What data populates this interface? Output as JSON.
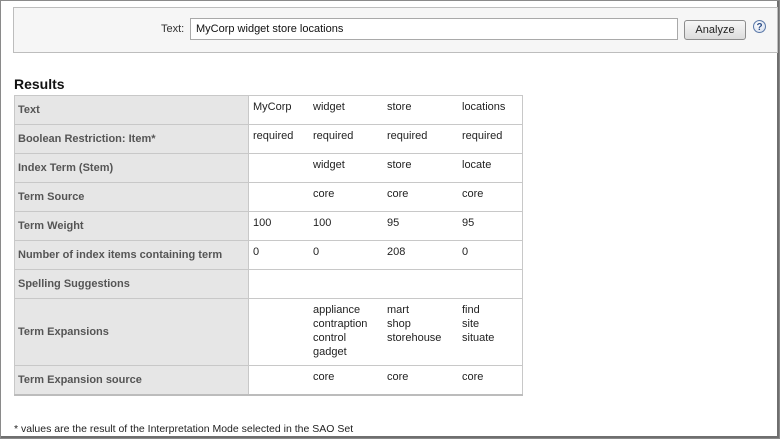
{
  "search": {
    "label": "Text:",
    "value": "MyCorp widget store locations",
    "analyze_label": "Analyze",
    "help_glyph": "?"
  },
  "results": {
    "heading": "Results",
    "rows": [
      {
        "label": "Text",
        "cells": [
          [
            "MyCorp"
          ],
          [
            "widget"
          ],
          [
            "store"
          ],
          [
            "locations"
          ]
        ]
      },
      {
        "label": "Boolean Restriction: Item*",
        "cells": [
          [
            "required"
          ],
          [
            "required"
          ],
          [
            "required"
          ],
          [
            "required"
          ]
        ]
      },
      {
        "label": "Index Term (Stem)",
        "cells": [
          [],
          [
            "widget"
          ],
          [
            "store"
          ],
          [
            "locate"
          ]
        ]
      },
      {
        "label": "Term Source",
        "cells": [
          [],
          [
            "core"
          ],
          [
            "core"
          ],
          [
            "core"
          ]
        ]
      },
      {
        "label": "Term Weight",
        "cells": [
          [
            "100"
          ],
          [
            "100"
          ],
          [
            "95"
          ],
          [
            "95"
          ]
        ]
      },
      {
        "label": "Number of index items containing term",
        "cells": [
          [
            "0"
          ],
          [
            "0"
          ],
          [
            "208"
          ],
          [
            "0"
          ]
        ]
      },
      {
        "label": "Spelling Suggestions",
        "cells": [
          [],
          [],
          [],
          []
        ]
      },
      {
        "label": "Term Expansions",
        "cells": [
          [],
          [
            "appliance",
            "contraption",
            "control",
            "gadget"
          ],
          [
            "mart",
            "shop",
            "storehouse"
          ],
          [
            "find",
            "site",
            "situate"
          ]
        ]
      },
      {
        "label": "Term Expansion source",
        "cells": [
          [],
          [
            "core"
          ],
          [
            "core"
          ],
          [
            "core"
          ]
        ]
      }
    ]
  },
  "footnote": "* values are the result of the Interpretation Mode selected in the SAO Set"
}
